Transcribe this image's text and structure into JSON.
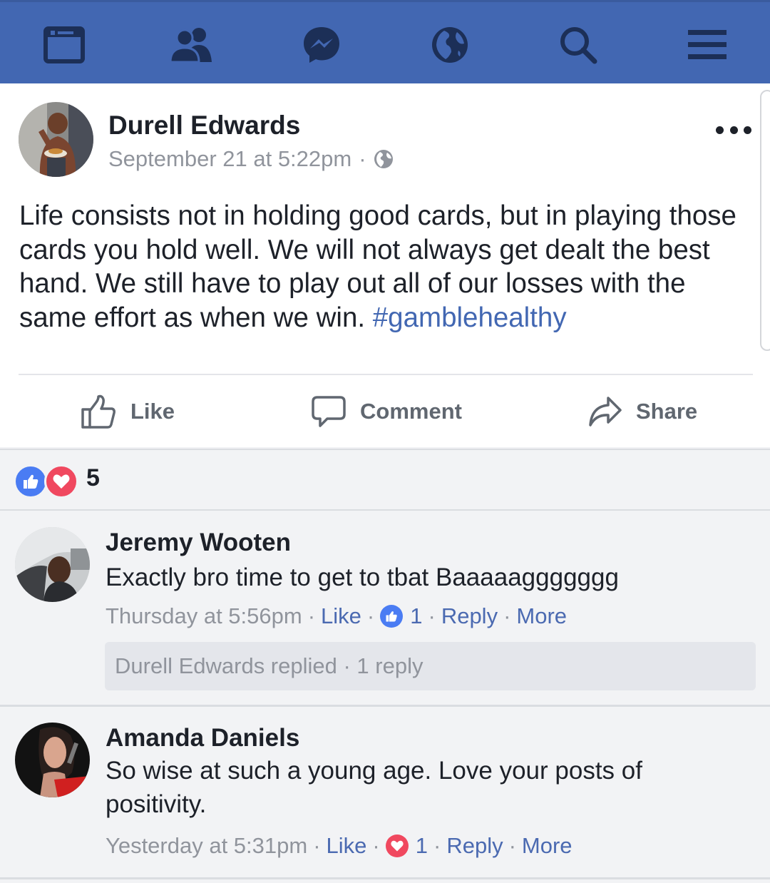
{
  "nav": {
    "items": [
      {
        "icon": "news-feed-icon"
      },
      {
        "icon": "friends-icon"
      },
      {
        "icon": "messenger-icon"
      },
      {
        "icon": "notifications-globe-icon"
      },
      {
        "icon": "search-icon"
      },
      {
        "icon": "menu-icon"
      }
    ],
    "bar_color": "#4267b2",
    "icon_color": "#1c2f57"
  },
  "post": {
    "author": "Durell Edwards",
    "timestamp": "September 21 at 5:22pm",
    "separator": "·",
    "privacy_icon": "globe-icon",
    "text": "Life consists not in holding good cards, but in playing those cards you hold well. We will not always get dealt the best hand. We still have to play out all of our losses with the same effort as when we win.",
    "hashtag": "#gamblehealthy",
    "actions": {
      "like": "Like",
      "comment": "Comment",
      "share": "Share"
    }
  },
  "reactions": {
    "types": [
      "like",
      "love"
    ],
    "count": "5",
    "like_color": "#4a7cf3",
    "love_color": "#f0485f"
  },
  "comments": [
    {
      "name": "Jeremy Wooten",
      "text": "Exactly bro time to get to tbat Baaaaaggggggg",
      "time": "Thursday at 5:56pm",
      "like": "Like",
      "reaction": "like",
      "reaction_count": "1",
      "reply": "Reply",
      "more": "More",
      "replies_summary": "Durell Edwards replied · 1 reply"
    },
    {
      "name": "Amanda Daniels",
      "text": "So wise at such a young age. Love your posts of positivity.",
      "time": "Yesterday at 5:31pm",
      "like": "Like",
      "reaction": "love",
      "reaction_count": "1",
      "reply": "Reply",
      "more": "More"
    }
  ],
  "link_color": "#4b6ab1",
  "meta_color": "#90949c"
}
